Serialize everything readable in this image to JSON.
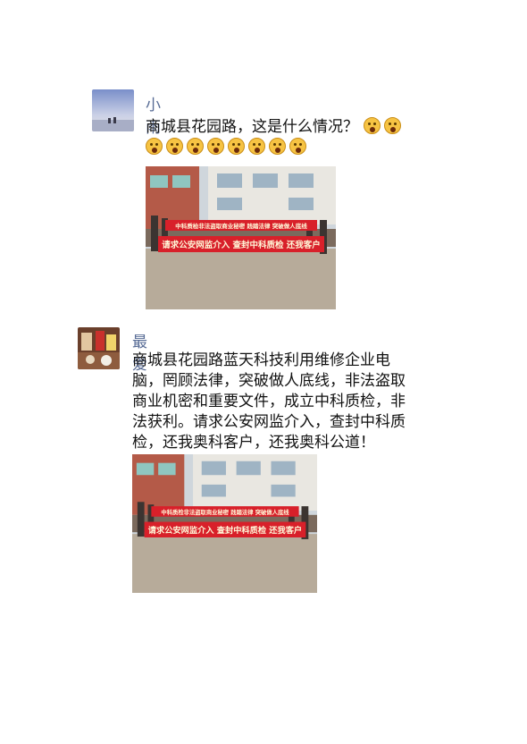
{
  "posts": [
    {
      "author": "小雨",
      "text": "商城县花园路，这是什么情况？",
      "emoji_count_line1": 2,
      "emoji_count_line2": 8,
      "emoji_icon": "screaming-face-emoji",
      "photo": {
        "banner_top": "中科质检非法盗取商业秘密  践踏法律  突破做人底线",
        "banner_bottom": "请求公安网监介入  查封中科质检  还我客户"
      }
    },
    {
      "author": "最爱",
      "text_lines": [
        "商城县花园路蓝天科技利用维修企业电",
        "脑，罔顾法律，突破做人底线，非法盗取",
        "商业机密和重要文件，成立中科质检，非",
        "法获利。请求公安网监介入，查封中科质",
        "检，还我奥科客户，还我奥科公道！"
      ],
      "photo": {
        "banner_top": "中科质检非法盗取商业秘密  践踏法律  突破做人底线",
        "banner_bottom": "请求公安网监介入  查封中科质检  还我客户"
      }
    }
  ],
  "colors": {
    "name": "#576b95",
    "banner": "#d8202a"
  }
}
